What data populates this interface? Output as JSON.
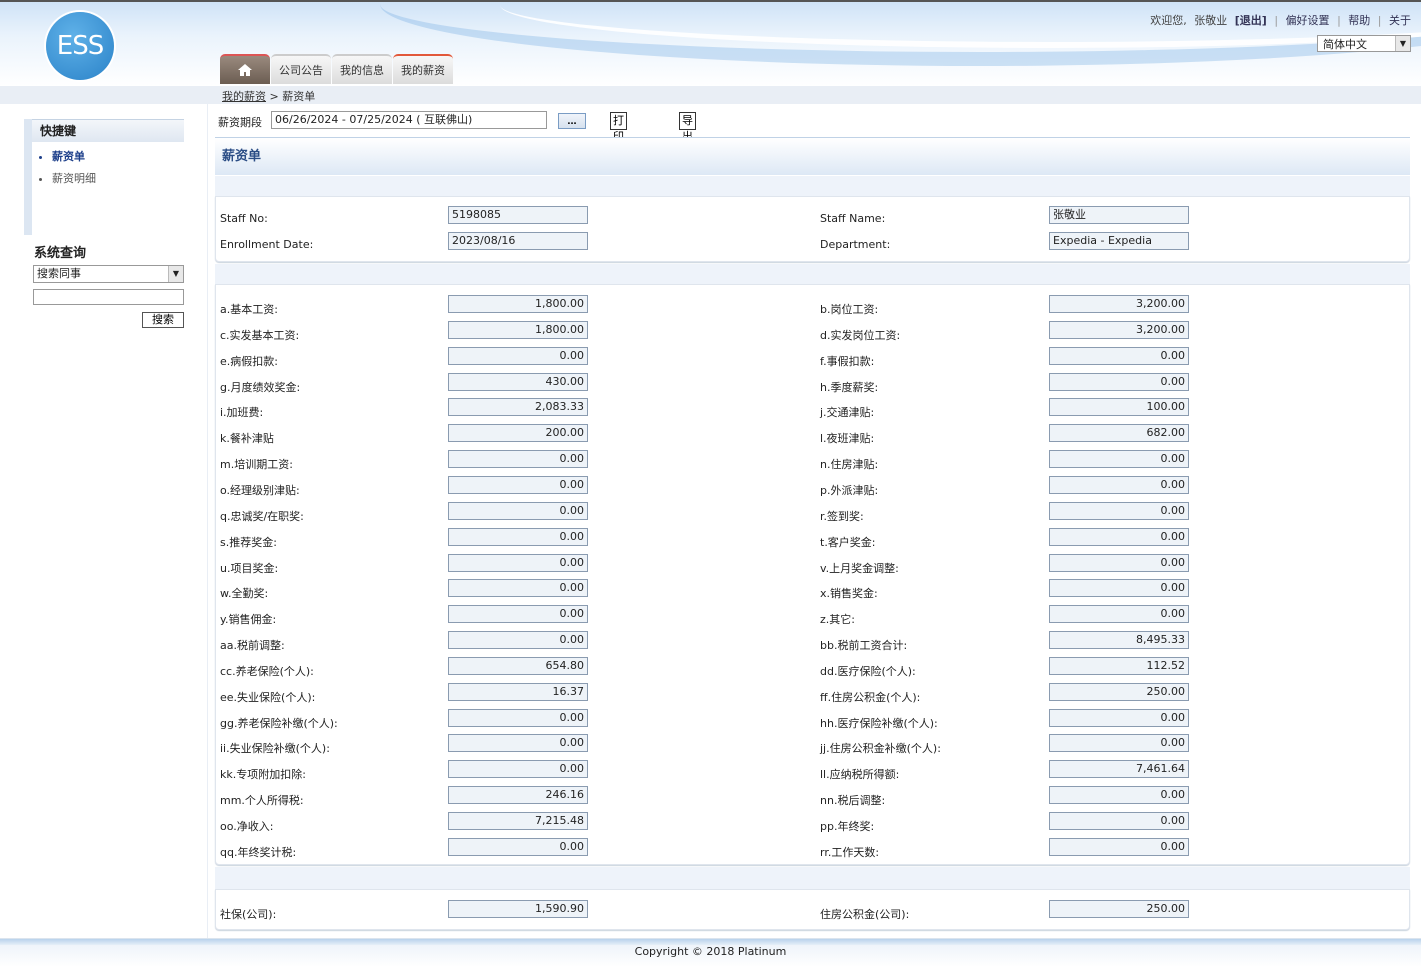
{
  "header": {
    "logo_text": "ESS",
    "welcome": "欢迎您,",
    "user": "张敬业",
    "logout": "[退出]",
    "preferences": "偏好设置",
    "help": "帮助",
    "about": "关于",
    "language": "简体中文",
    "tabs": [
      "公司公告",
      "我的信息",
      "我的薪资"
    ]
  },
  "breadcrumb": {
    "parent": "我的薪资",
    "separator": ">",
    "current": "薪资单"
  },
  "sidebar": {
    "quick_title": "快捷键",
    "quick_items": [
      "薪资单",
      "薪资明细"
    ],
    "query_title": "系统查询",
    "query_select": "搜索同事",
    "query_button": "搜索"
  },
  "toolbar": {
    "period_label": "薪资期段",
    "period_value": "06/26/2024 - 07/25/2024 ( 互联佛山)",
    "dots": "...",
    "print": "打印薪资单",
    "export": "导出工资单"
  },
  "title": "薪资单",
  "staff": {
    "staff_no_label": "Staff No:",
    "staff_no": "5198085",
    "staff_name_label": "Staff Name:",
    "staff_name": "张敬业",
    "enroll_label": "Enrollment Date:",
    "enroll": "2023/08/16",
    "dept_label": "Department:",
    "dept": "Expedia - Expedia"
  },
  "pay_rows": [
    {
      "l": "a.基本工资:",
      "lv": "1,800.00",
      "r": "b.岗位工资:",
      "rv": "3,200.00"
    },
    {
      "l": "c.实发基本工资:",
      "lv": "1,800.00",
      "r": "d.实发岗位工资:",
      "rv": "3,200.00"
    },
    {
      "l": "e.病假扣款:",
      "lv": "0.00",
      "r": "f.事假扣款:",
      "rv": "0.00"
    },
    {
      "l": "g.月度绩效奖金:",
      "lv": "430.00",
      "r": "h.季度薪奖:",
      "rv": "0.00"
    },
    {
      "l": "i.加班费:",
      "lv": "2,083.33",
      "r": "j.交通津贴:",
      "rv": "100.00"
    },
    {
      "l": "k.餐补津贴",
      "lv": "200.00",
      "r": "l.夜班津贴:",
      "rv": "682.00"
    },
    {
      "l": "m.培训期工资:",
      "lv": "0.00",
      "r": "n.住房津贴:",
      "rv": "0.00"
    },
    {
      "l": "o.经理级别津贴:",
      "lv": "0.00",
      "r": "p.外派津贴:",
      "rv": "0.00"
    },
    {
      "l": "q.忠诚奖/在职奖:",
      "lv": "0.00",
      "r": "r.签到奖:",
      "rv": "0.00"
    },
    {
      "l": "s.推荐奖金:",
      "lv": "0.00",
      "r": "t.客户奖金:",
      "rv": "0.00"
    },
    {
      "l": "u.项目奖金:",
      "lv": "0.00",
      "r": "v.上月奖金调整:",
      "rv": "0.00"
    },
    {
      "l": "w.全勤奖:",
      "lv": "0.00",
      "r": "x.销售奖金:",
      "rv": "0.00"
    },
    {
      "l": "y.销售佣金:",
      "lv": "0.00",
      "r": "z.其它:",
      "rv": "0.00"
    },
    {
      "l": "aa.税前调整:",
      "lv": "0.00",
      "r": "bb.税前工资合计:",
      "rv": "8,495.33"
    },
    {
      "l": "cc.养老保险(个人):",
      "lv": "654.80",
      "r": "dd.医疗保险(个人):",
      "rv": "112.52"
    },
    {
      "l": "ee.失业保险(个人):",
      "lv": "16.37",
      "r": "ff.住房公积金(个人):",
      "rv": "250.00"
    },
    {
      "l": "gg.养老保险补缴(个人):",
      "lv": "0.00",
      "r": "hh.医疗保险补缴(个人):",
      "rv": "0.00"
    },
    {
      "l": "ii.失业保险补缴(个人):",
      "lv": "0.00",
      "r": "jj.住房公积金补缴(个人):",
      "rv": "0.00"
    },
    {
      "l": "kk.专项附加扣除:",
      "lv": "0.00",
      "r": "ll.应纳税所得额:",
      "rv": "7,461.64"
    },
    {
      "l": "mm.个人所得税:",
      "lv": "246.16",
      "r": "nn.税后调整:",
      "rv": "0.00"
    },
    {
      "l": "oo.净收入:",
      "lv": "7,215.48",
      "r": "pp.年终奖:",
      "rv": "0.00"
    },
    {
      "l": "qq.年终奖计税:",
      "lv": "0.00",
      "r": "rr.工作天数:",
      "rv": "0.00"
    }
  ],
  "company": {
    "social_label": "社保(公司):",
    "social": "1,590.90",
    "fund_label": "住房公积金(公司):",
    "fund": "250.00"
  },
  "footer": "Copyright © 2018 Platinum"
}
